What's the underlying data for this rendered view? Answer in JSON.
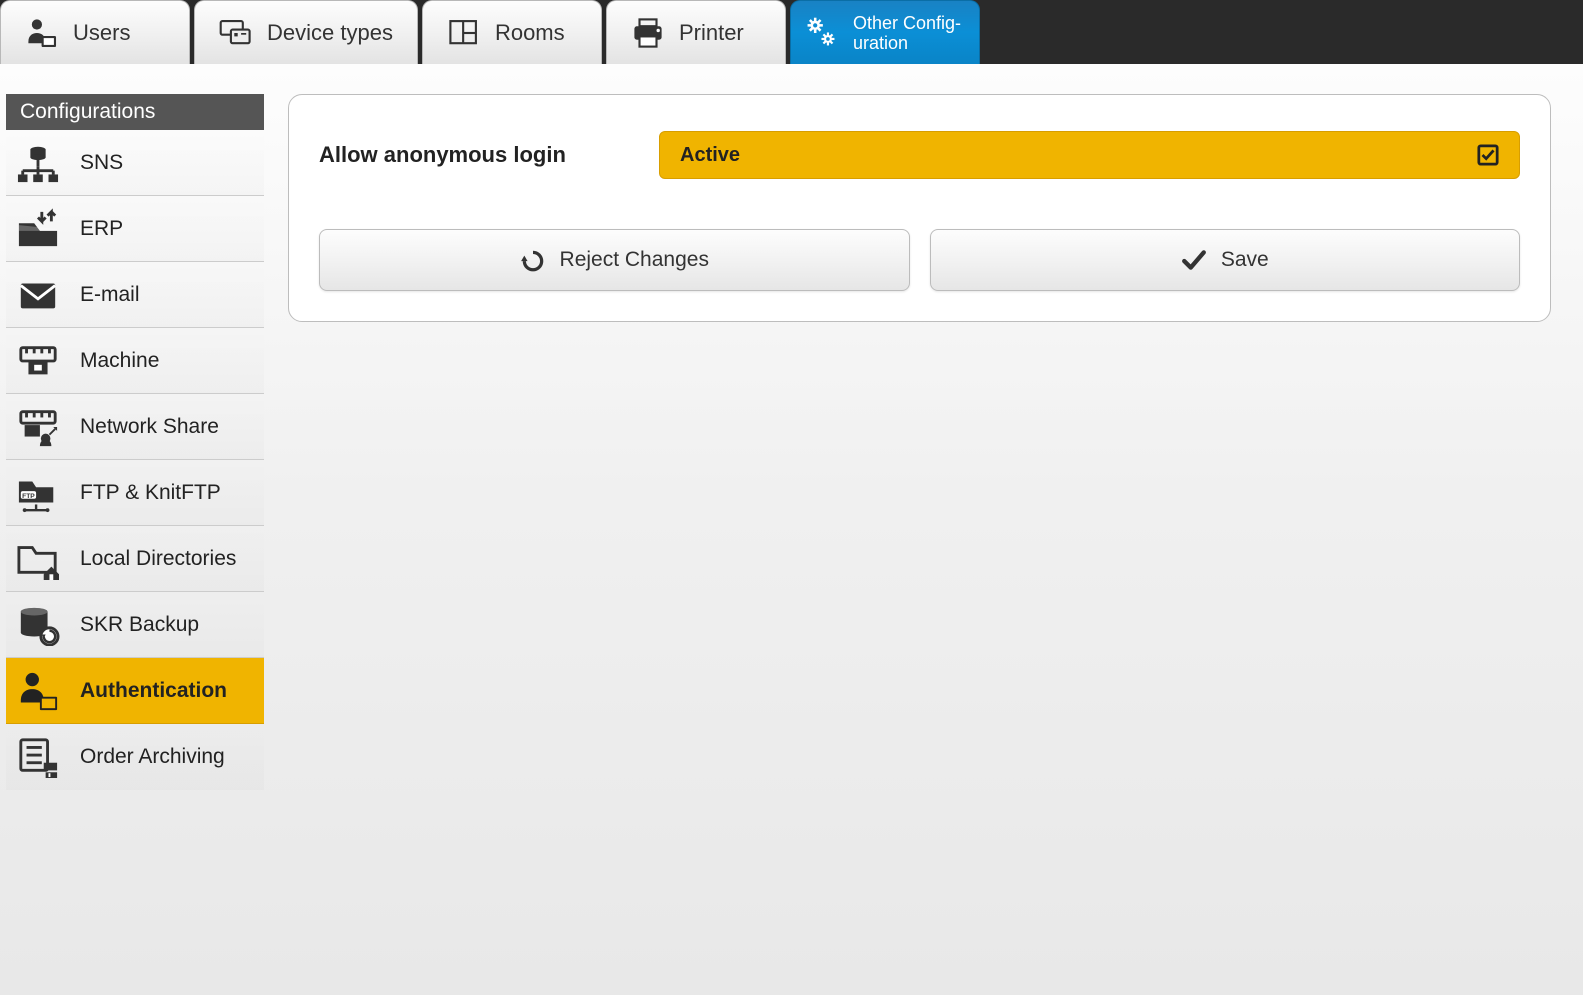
{
  "tabs": {
    "users": "Users",
    "device_types": "Device types",
    "rooms": "Rooms",
    "printer": "Printer",
    "other_config": "Other Config-uration"
  },
  "sidebar": {
    "header": "Configurations",
    "items": [
      {
        "label": "SNS"
      },
      {
        "label": "ERP"
      },
      {
        "label": "E-mail"
      },
      {
        "label": "Machine"
      },
      {
        "label": "Network Share"
      },
      {
        "label": "FTP & KnitFTP"
      },
      {
        "label": "Local Directories"
      },
      {
        "label": "SKR Backup"
      },
      {
        "label": "Authentication",
        "active": true
      },
      {
        "label": "Order Archiving"
      }
    ]
  },
  "content": {
    "setting_label": "Allow anonymous login",
    "toggle_value": "Active",
    "reject_label": "Reject Changes",
    "save_label": "Save"
  },
  "colors": {
    "accent_blue": "#0b8fd6",
    "accent_yellow": "#f0b400"
  }
}
